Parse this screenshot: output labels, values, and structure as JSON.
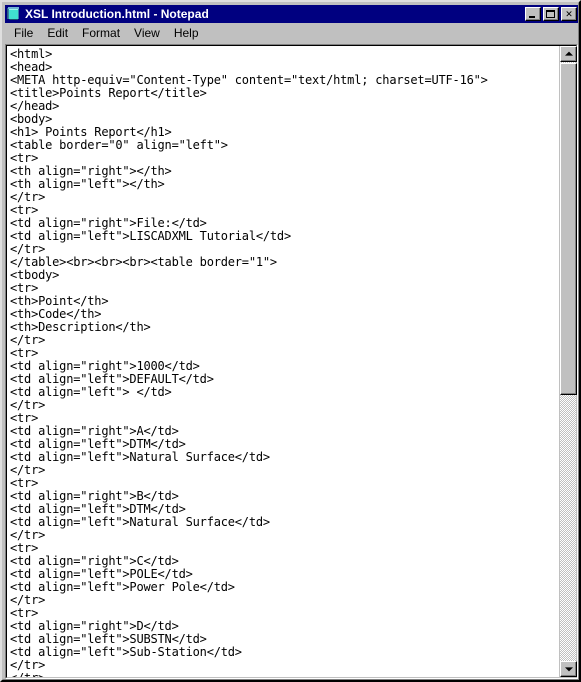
{
  "window": {
    "title": "XSL Introduction.html - Notepad",
    "icon": "notepad-document-icon",
    "buttons": {
      "minimize": "_",
      "maximize": "□",
      "close": "✕"
    }
  },
  "menubar": {
    "items": [
      {
        "label": "File"
      },
      {
        "label": "Edit"
      },
      {
        "label": "Format"
      },
      {
        "label": "View"
      },
      {
        "label": "Help"
      }
    ]
  },
  "editor": {
    "content": "<html>\n<head>\n<META http-equiv=\"Content-Type\" content=\"text/html; charset=UTF-16\">\n<title>Points Report</title>\n</head>\n<body>\n<h1> Points Report</h1>\n<table border=\"0\" align=\"left\">\n<tr>\n<th align=\"right\"></th>\n<th align=\"left\"></th>\n</tr>\n<tr>\n<td align=\"right\">File:</td>\n<td align=\"left\">LISCADXML Tutorial</td>\n</tr>\n</table><br><br><br><table border=\"1\">\n<tbody>\n<tr>\n<th>Point</th>\n<th>Code</th>\n<th>Description</th>\n</tr>\n<tr>\n<td align=\"right\">1000</td>\n<td align=\"left\">DEFAULT</td>\n<td align=\"left\"> </td>\n</tr>\n<tr>\n<td align=\"right\">A</td>\n<td align=\"left\">DTM</td>\n<td align=\"left\">Natural Surface</td>\n</tr>\n<tr>\n<td align=\"right\">B</td>\n<td align=\"left\">DTM</td>\n<td align=\"left\">Natural Surface</td>\n</tr>\n<tr>\n<td align=\"right\">C</td>\n<td align=\"left\">POLE</td>\n<td align=\"left\">Power Pole</td>\n</tr>\n<tr>\n<td align=\"right\">D</td>\n<td align=\"left\">SUBSTN</td>\n<td align=\"left\">Sub-Station</td>\n</tr>\n</tr>"
  },
  "scrollbar": {
    "up_arrow": "scroll-up-arrow",
    "down_arrow": "scroll-down-arrow"
  },
  "colors": {
    "titlebar": "#000080",
    "chrome": "#c0c0c0",
    "text": "#000000",
    "editor_bg": "#ffffff"
  }
}
